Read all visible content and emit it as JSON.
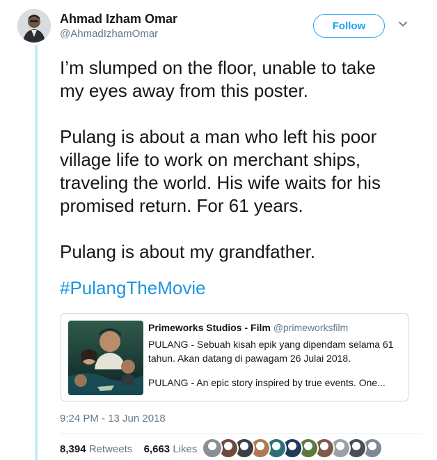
{
  "author": {
    "display_name": "Ahmad Izham Omar",
    "handle": "@AhmadIzhamOmar",
    "avatar_icon": "profile-photo"
  },
  "follow_label": "Follow",
  "tweet": {
    "paragraphs": [
      [
        "I’m slumped on the floor, unable to take",
        "my eyes away from this poster."
      ],
      [
        "Pulang is about a man who left his poor",
        "village life to work on merchant ships,",
        "traveling the world. His wife waits for his",
        "promised return. For 61 years."
      ],
      [
        "Pulang is about my grandfather."
      ]
    ],
    "hashtag": "#PulangTheMovie"
  },
  "quoted_tweet": {
    "name": "Primeworks Studios - Film",
    "handle": "@primeworksfilm",
    "lines": [
      "PULANG - Sebuah kisah epik yang dipendam selama 61",
      "tahun. Akan datang di pawagam 26 Julai 2018.",
      "",
      "PULANG - An epic story inspired by true events. One..."
    ]
  },
  "timestamp": "9:24 PM - 13 Jun 2018",
  "stats": {
    "retweets_count": "8,394",
    "retweets_label": "Retweets",
    "likes_count": "6,663",
    "likes_label": "Likes"
  },
  "likers": [
    "#8a8f94",
    "#6b4b3e",
    "#3a3f45",
    "#b07a55",
    "#2f6f7a",
    "#1f3a5a",
    "#5b7a3a",
    "#7a5b4b",
    "#9aa1a8",
    "#4a4f55",
    "#7d8a96"
  ],
  "colors": {
    "accent": "#1da1f2",
    "hashtag": "#1b95e0",
    "muted": "#657786",
    "thread": "#c4ecfd"
  }
}
